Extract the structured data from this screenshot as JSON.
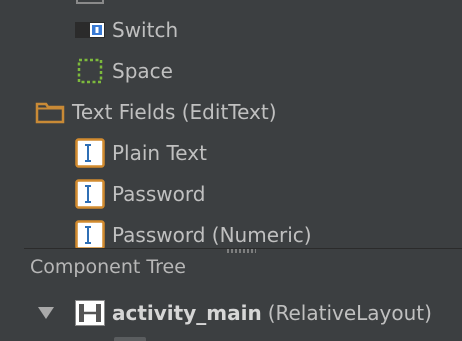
{
  "palette": {
    "items": [
      {
        "label": "Switch",
        "icon": "switch-icon"
      },
      {
        "label": "Space",
        "icon": "space-icon"
      },
      {
        "label": "Text Fields (EditText)",
        "icon": "folder-icon"
      },
      {
        "label": "Plain Text",
        "icon": "edittext-icon"
      },
      {
        "label": "Password",
        "icon": "edittext-icon"
      },
      {
        "label": "Password (Numeric)",
        "icon": "edittext-icon"
      }
    ]
  },
  "component_tree": {
    "title": "Component Tree",
    "root": {
      "name": "activity_main",
      "type": "(RelativeLayout)",
      "expanded": true,
      "icon": "relative-layout-icon"
    }
  },
  "colors": {
    "background": "#3c3f41",
    "text": "#c0c0c0",
    "icon_orange": "#d28b2f",
    "icon_green": "#7dba3c",
    "icon_blue": "#4a90d9"
  }
}
